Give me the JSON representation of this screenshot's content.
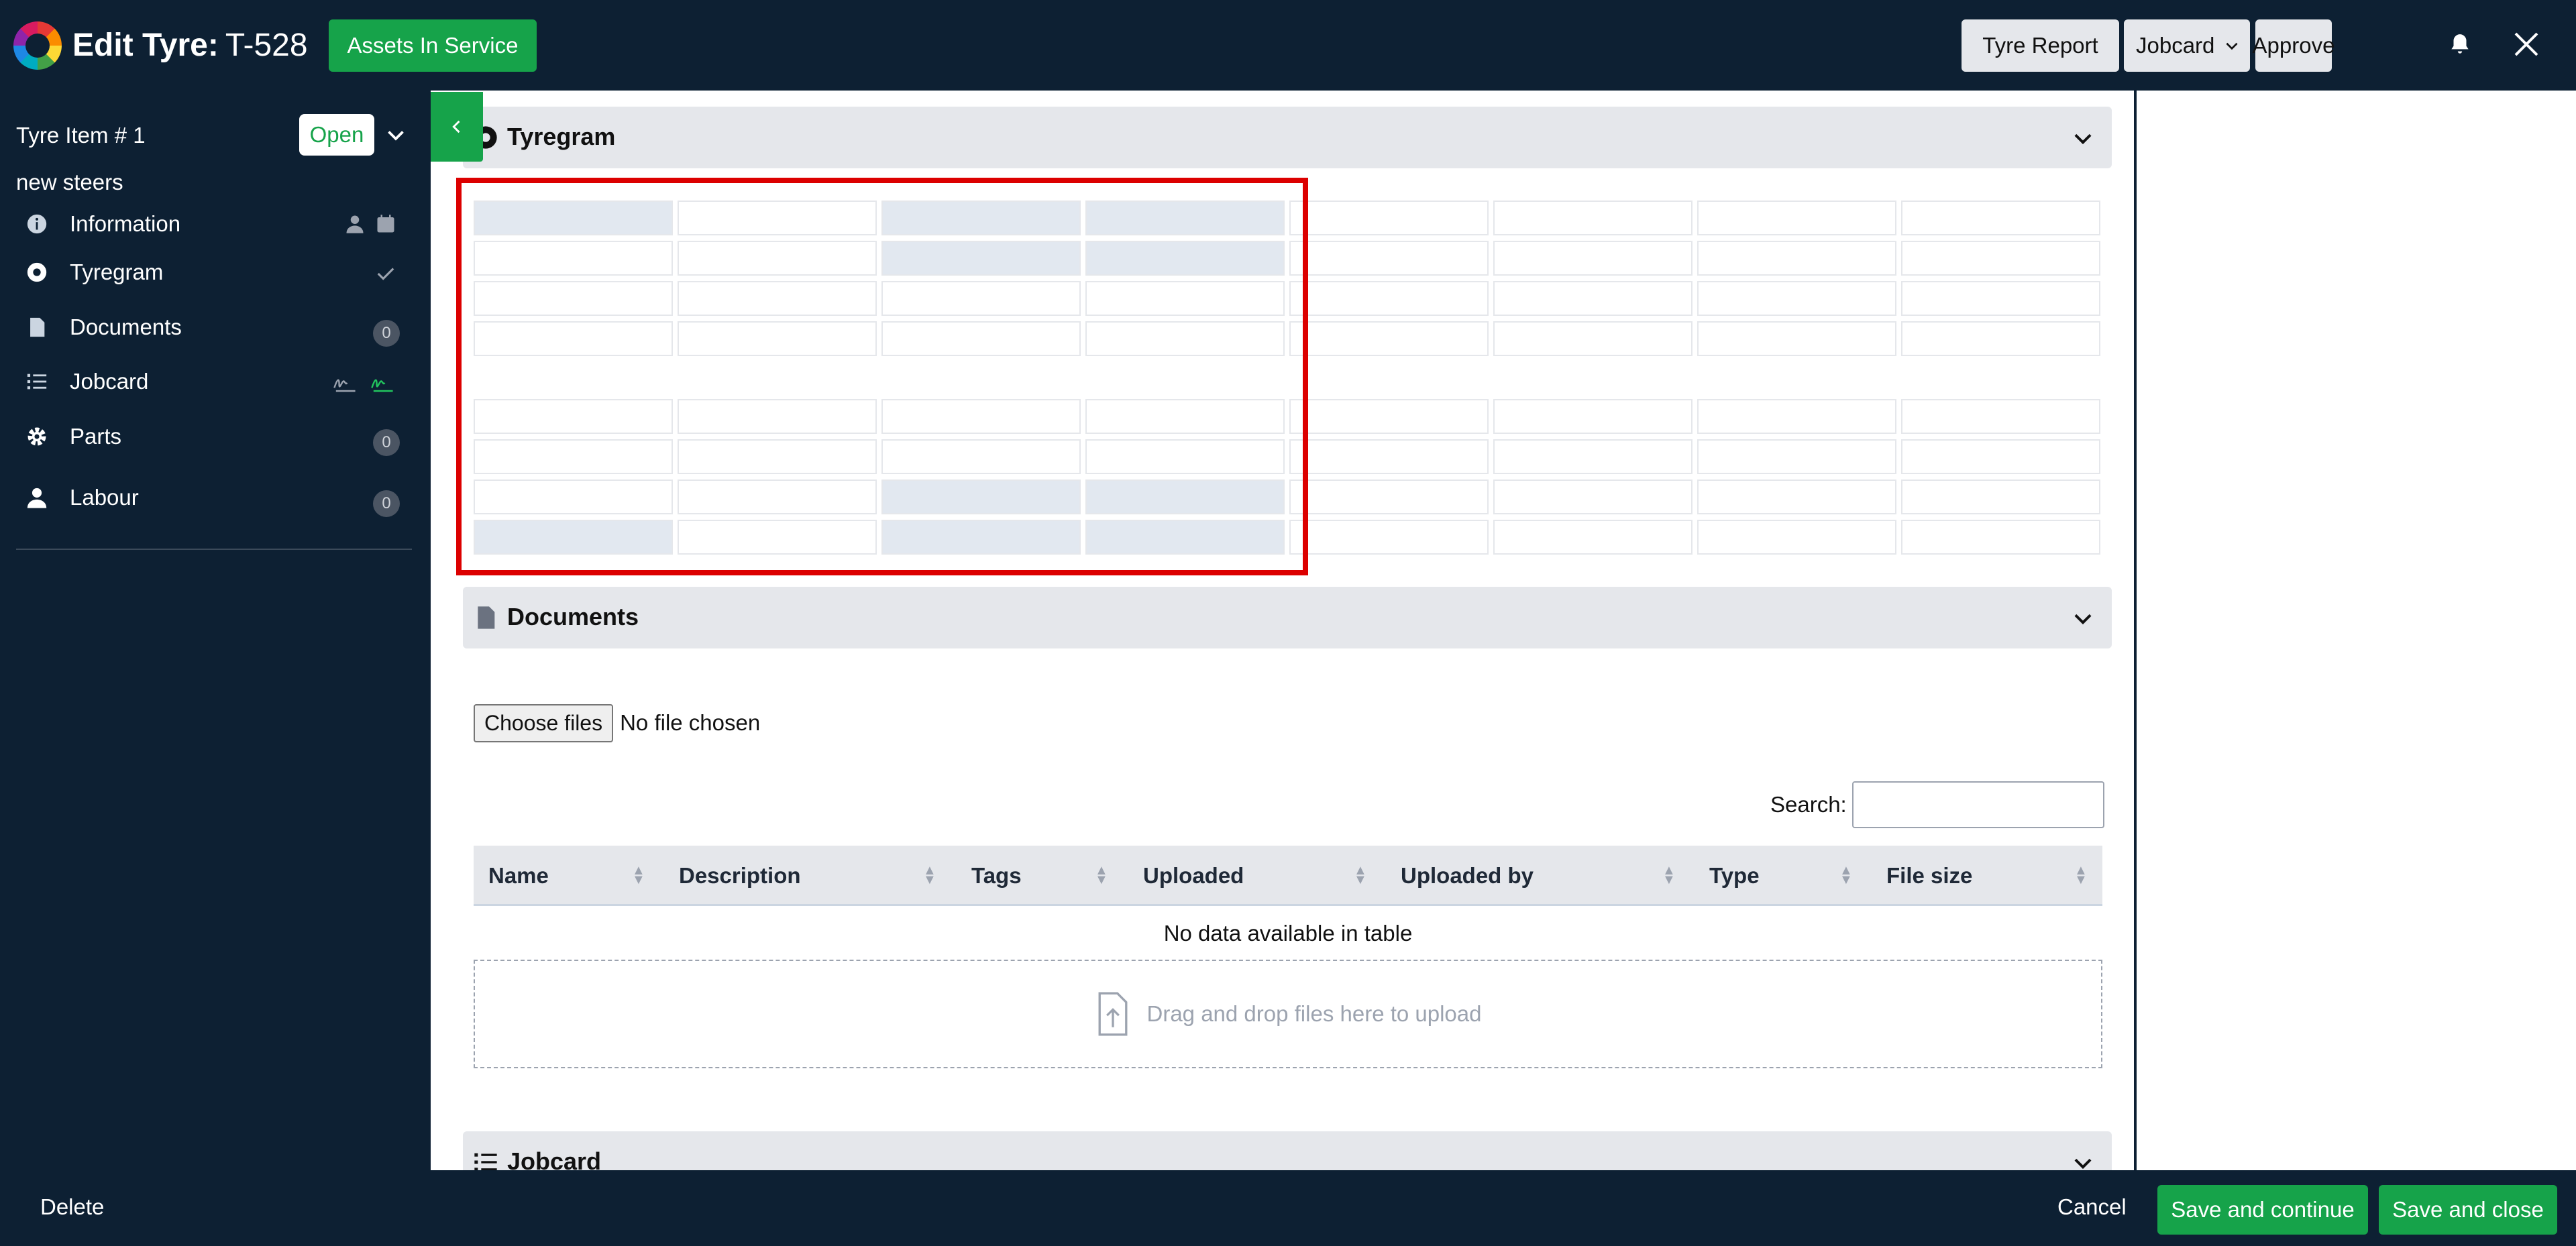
{
  "header": {
    "title_prefix": "Edit Tyre:",
    "title_code": "T-528",
    "assets_button": "Assets In Service",
    "tyre_report_button": "Tyre Report",
    "jobcard_select": "Jobcard",
    "approve_button": "Approve"
  },
  "sidebar": {
    "item_title": "Tyre Item # 1",
    "status_badge": "Open",
    "sub_title": "new steers",
    "nav": [
      {
        "label": "Information",
        "icon": "info-icon"
      },
      {
        "label": "Tyregram",
        "icon": "tyre-icon"
      },
      {
        "label": "Documents",
        "icon": "document-icon",
        "badge": "0"
      },
      {
        "label": "Jobcard",
        "icon": "list-icon"
      },
      {
        "label": "Parts",
        "icon": "gear-icon",
        "badge": "0"
      },
      {
        "label": "Labour",
        "icon": "user-icon",
        "badge": "0"
      }
    ]
  },
  "tyregram": {
    "title": "Tyregram"
  },
  "documents": {
    "title": "Documents",
    "choose_files": "Choose files",
    "no_file": "No file chosen",
    "search_label": "Search:",
    "columns": [
      "Name",
      "Description",
      "Tags",
      "Uploaded",
      "Uploaded by",
      "Type",
      "File size"
    ],
    "empty_message": "No data available in table",
    "dropzone_text": "Drag and drop files here to upload"
  },
  "jobcard": {
    "title": "Jobcard"
  },
  "footer": {
    "delete": "Delete",
    "cancel": "Cancel",
    "save_continue": "Save and continue",
    "save_close": "Save and close"
  },
  "colors": {
    "navy": "#0d2033",
    "green": "#16a34a",
    "highlight_red": "#dc0000"
  }
}
